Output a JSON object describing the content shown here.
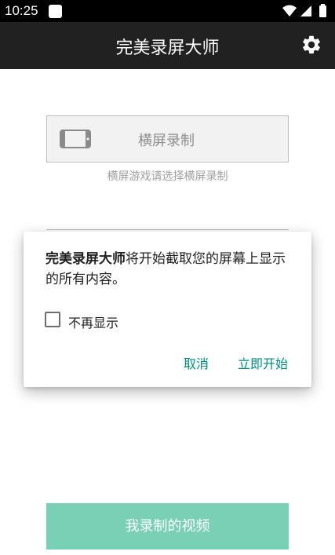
{
  "status_bar": {
    "time": "10:25",
    "icons": [
      "notification-icon",
      "wifi-icon",
      "signal-icon",
      "battery-icon"
    ]
  },
  "app_bar": {
    "title": "完美录屏大师",
    "settings_icon": "gear-icon"
  },
  "main": {
    "landscape_button": {
      "icon": "landscape-phone-icon",
      "label": "横屏录制"
    },
    "landscape_hint": "横屏游戏请选择横屏录制",
    "videos_button_label": "我录制的视频"
  },
  "dialog": {
    "message_app": "完美录屏大师",
    "message_rest": "将开始截取您的屏幕上显示的所有内容。",
    "checkbox_label": "不再显示",
    "checkbox_checked": false,
    "cancel_label": "取消",
    "start_label": "立即开始"
  },
  "colors": {
    "app_bar": "#212121",
    "accent": "#00897b",
    "videos_button": "#7ad0b5"
  }
}
